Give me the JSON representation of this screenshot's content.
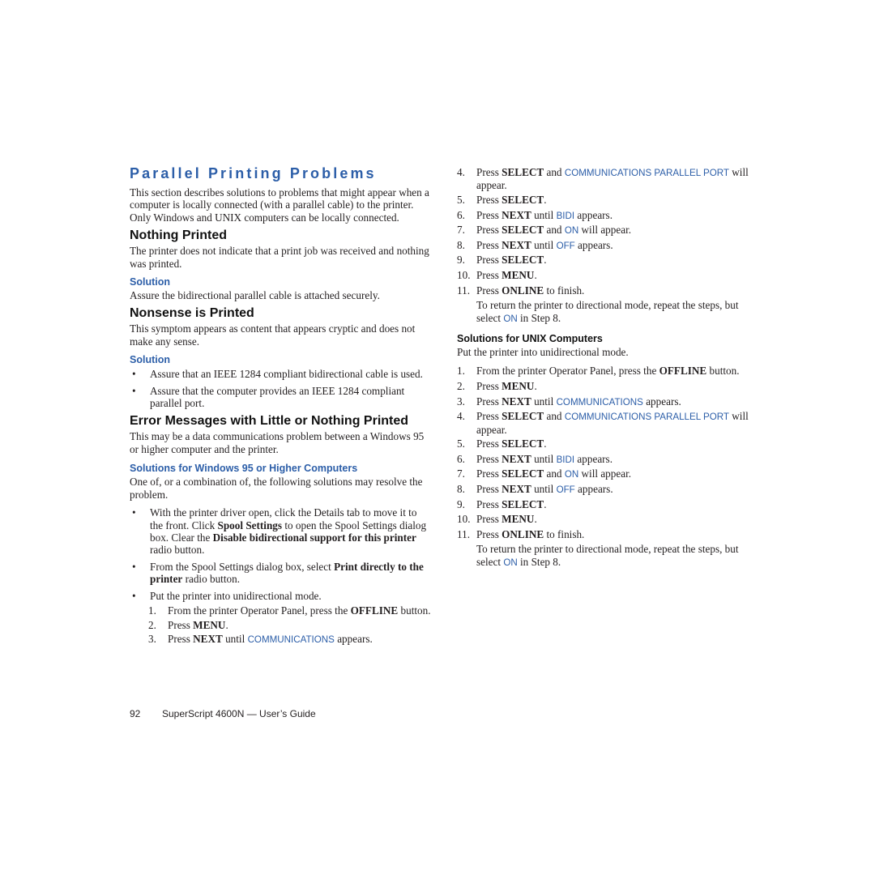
{
  "colors": {
    "accent": "#2c5ea8",
    "text": "#231f20"
  },
  "left": {
    "title": "Parallel Printing Problems",
    "intro": "This section describes solutions to problems that might appear when a computer is locally connected (with a parallel cable) to the printer. Only Windows and UNIX computers can be locally connected.",
    "nothing_printed": {
      "heading": "Nothing Printed",
      "desc": "The printer does not indicate that a print job was received and nothing was printed.",
      "solution_heading": "Solution",
      "solution_text": "Assure the bidirectional parallel cable is attached securely."
    },
    "nonsense": {
      "heading": "Nonsense is Printed",
      "desc": "This symptom appears as content that appears cryptic and does not make any sense.",
      "solution_heading": "Solution",
      "bullets": [
        "Assure that an IEEE 1284 compliant bidirectional cable is used.",
        "Assure that the computer provides an IEEE 1284 compliant parallel port."
      ]
    },
    "error_messages": {
      "heading": "Error Messages with Little or Nothing Printed",
      "desc": "This may be a data communications problem between a Windows 95 or higher computer and the printer.",
      "win_heading": "Solutions for Windows 95 or Higher Computers",
      "win_desc": "One of, or a combination of, the following solutions may resolve the problem.",
      "bullet1": {
        "a": "With the printer driver open, click the Details tab to move it to the front. Click ",
        "b1": "Spool Settings",
        "c": " to open the Spool Settings dialog box. Clear the ",
        "b2": "Disable bidirectional support for this printer",
        "d": " radio button."
      },
      "bullet2": {
        "a": "From the Spool Settings dialog box, select ",
        "b1": "Print directly to the printer",
        "c": " radio button."
      },
      "bullet3": "Put the printer into unidirectional mode.",
      "steps": [
        {
          "num": "1.",
          "a": "From the printer Operator Panel, press the ",
          "b": "OFFLINE",
          "c": " button."
        },
        {
          "num": "2.",
          "a": "Press ",
          "b": "MENU",
          "c": "."
        },
        {
          "num": "3.",
          "a": "Press ",
          "b": "NEXT",
          "c": " until ",
          "kw": "COMMUNICATIONS",
          "d": " appears."
        }
      ]
    }
  },
  "right": {
    "steps_cont": [
      {
        "num": "4.",
        "a": "Press ",
        "b": "SELECT",
        "c": " and ",
        "kw": "COMMUNICATIONS PARALLEL PORT",
        "d": " will appear."
      },
      {
        "num": "5.",
        "a": "Press ",
        "b": "SELECT",
        "c": ".",
        "kw": "",
        "d": ""
      },
      {
        "num": "6.",
        "a": "Press ",
        "b": "NEXT",
        "c": " until ",
        "kw": "BIDI",
        "d": " appears."
      },
      {
        "num": "7.",
        "a": "Press ",
        "b": "SELECT",
        "c": " and ",
        "kw": "ON",
        "d": " will appear."
      },
      {
        "num": "8.",
        "a": "Press ",
        "b": "NEXT",
        "c": " until ",
        "kw": "OFF",
        "d": " appears."
      },
      {
        "num": "9.",
        "a": "Press ",
        "b": "SELECT",
        "c": ".",
        "kw": "",
        "d": ""
      },
      {
        "num": "10.",
        "a": "Press ",
        "b": "MENU",
        "c": ".",
        "kw": "",
        "d": ""
      },
      {
        "num": "11.",
        "a": "Press ",
        "b": "ONLINE",
        "c": " to finish.",
        "kw": "",
        "d": ""
      }
    ],
    "return_note": {
      "a": "To return the printer to directional mode, repeat the steps, but select ",
      "kw": "ON",
      "b": " in Step 8."
    },
    "unix": {
      "heading": "Solutions for UNIX Computers",
      "desc": "Put the printer into unidirectional mode.",
      "steps": [
        {
          "num": "1.",
          "a": "From the printer Operator Panel, press the ",
          "b": "OFFLINE",
          "c": " button.",
          "kw": "",
          "d": ""
        },
        {
          "num": "2.",
          "a": "Press ",
          "b": "MENU",
          "c": ".",
          "kw": "",
          "d": ""
        },
        {
          "num": "3.",
          "a": "Press ",
          "b": "NEXT",
          "c": " until ",
          "kw": "COMMUNICATIONS",
          "d": " appears."
        },
        {
          "num": "4.",
          "a": "Press ",
          "b": "SELECT",
          "c": " and ",
          "kw": "COMMUNICATIONS PARALLEL PORT",
          "d": " will appear."
        },
        {
          "num": "5.",
          "a": "Press ",
          "b": "SELECT",
          "c": ".",
          "kw": "",
          "d": ""
        },
        {
          "num": "6.",
          "a": "Press ",
          "b": "NEXT",
          "c": " until ",
          "kw": "BIDI",
          "d": " appears."
        },
        {
          "num": "7.",
          "a": "Press ",
          "b": "SELECT",
          "c": " and ",
          "kw": "ON",
          "d": " will appear."
        },
        {
          "num": "8.",
          "a": "Press ",
          "b": "NEXT",
          "c": " until ",
          "kw": "OFF",
          "d": " appears."
        },
        {
          "num": "9.",
          "a": "Press ",
          "b": "SELECT",
          "c": ".",
          "kw": "",
          "d": ""
        },
        {
          "num": "10.",
          "a": "Press ",
          "b": "MENU",
          "c": ".",
          "kw": "",
          "d": ""
        },
        {
          "num": "11.",
          "a": "Press ",
          "b": "ONLINE",
          "c": " to finish.",
          "kw": "",
          "d": ""
        }
      ],
      "return_note": {
        "a": "To return the printer to directional mode, repeat the steps, but select ",
        "kw": "ON",
        "b": " in Step 8."
      }
    }
  },
  "footer": {
    "page_number": "92",
    "title": "SuperScript 4600N — User’s Guide"
  },
  "bullet_glyph": "•"
}
